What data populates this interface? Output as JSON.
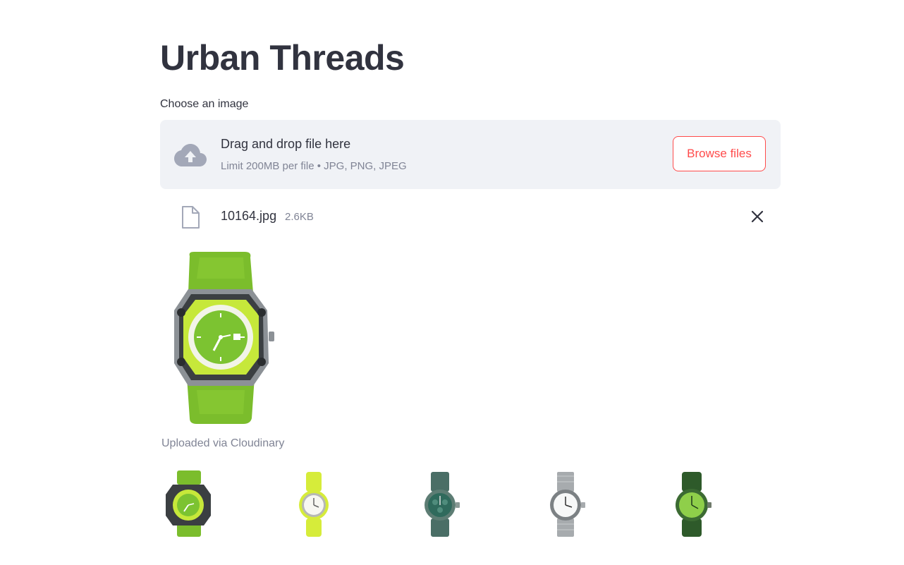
{
  "page": {
    "title": "Urban Threads"
  },
  "uploader": {
    "label": "Choose an image",
    "drop_text": "Drag and drop file here",
    "limit_text": "Limit 200MB per file • JPG, PNG, JPEG",
    "browse_label": "Browse files",
    "icon": "cloud-upload-icon"
  },
  "file": {
    "name": "10164.jpg",
    "size": "2.6KB",
    "icon": "file-icon",
    "remove_icon": "close-icon"
  },
  "preview": {
    "caption": "Uploaded via Cloudinary"
  },
  "recommendations": [
    {
      "name": "green-sport-watch"
    },
    {
      "name": "lime-strap-watch"
    },
    {
      "name": "teal-chronograph-watch"
    },
    {
      "name": "silver-steel-watch"
    },
    {
      "name": "olive-green-watch"
    }
  ],
  "colors": {
    "accent": "#ff4b4b",
    "text": "#31333f",
    "muted": "#808495",
    "dropzone_bg": "#f0f2f6"
  }
}
